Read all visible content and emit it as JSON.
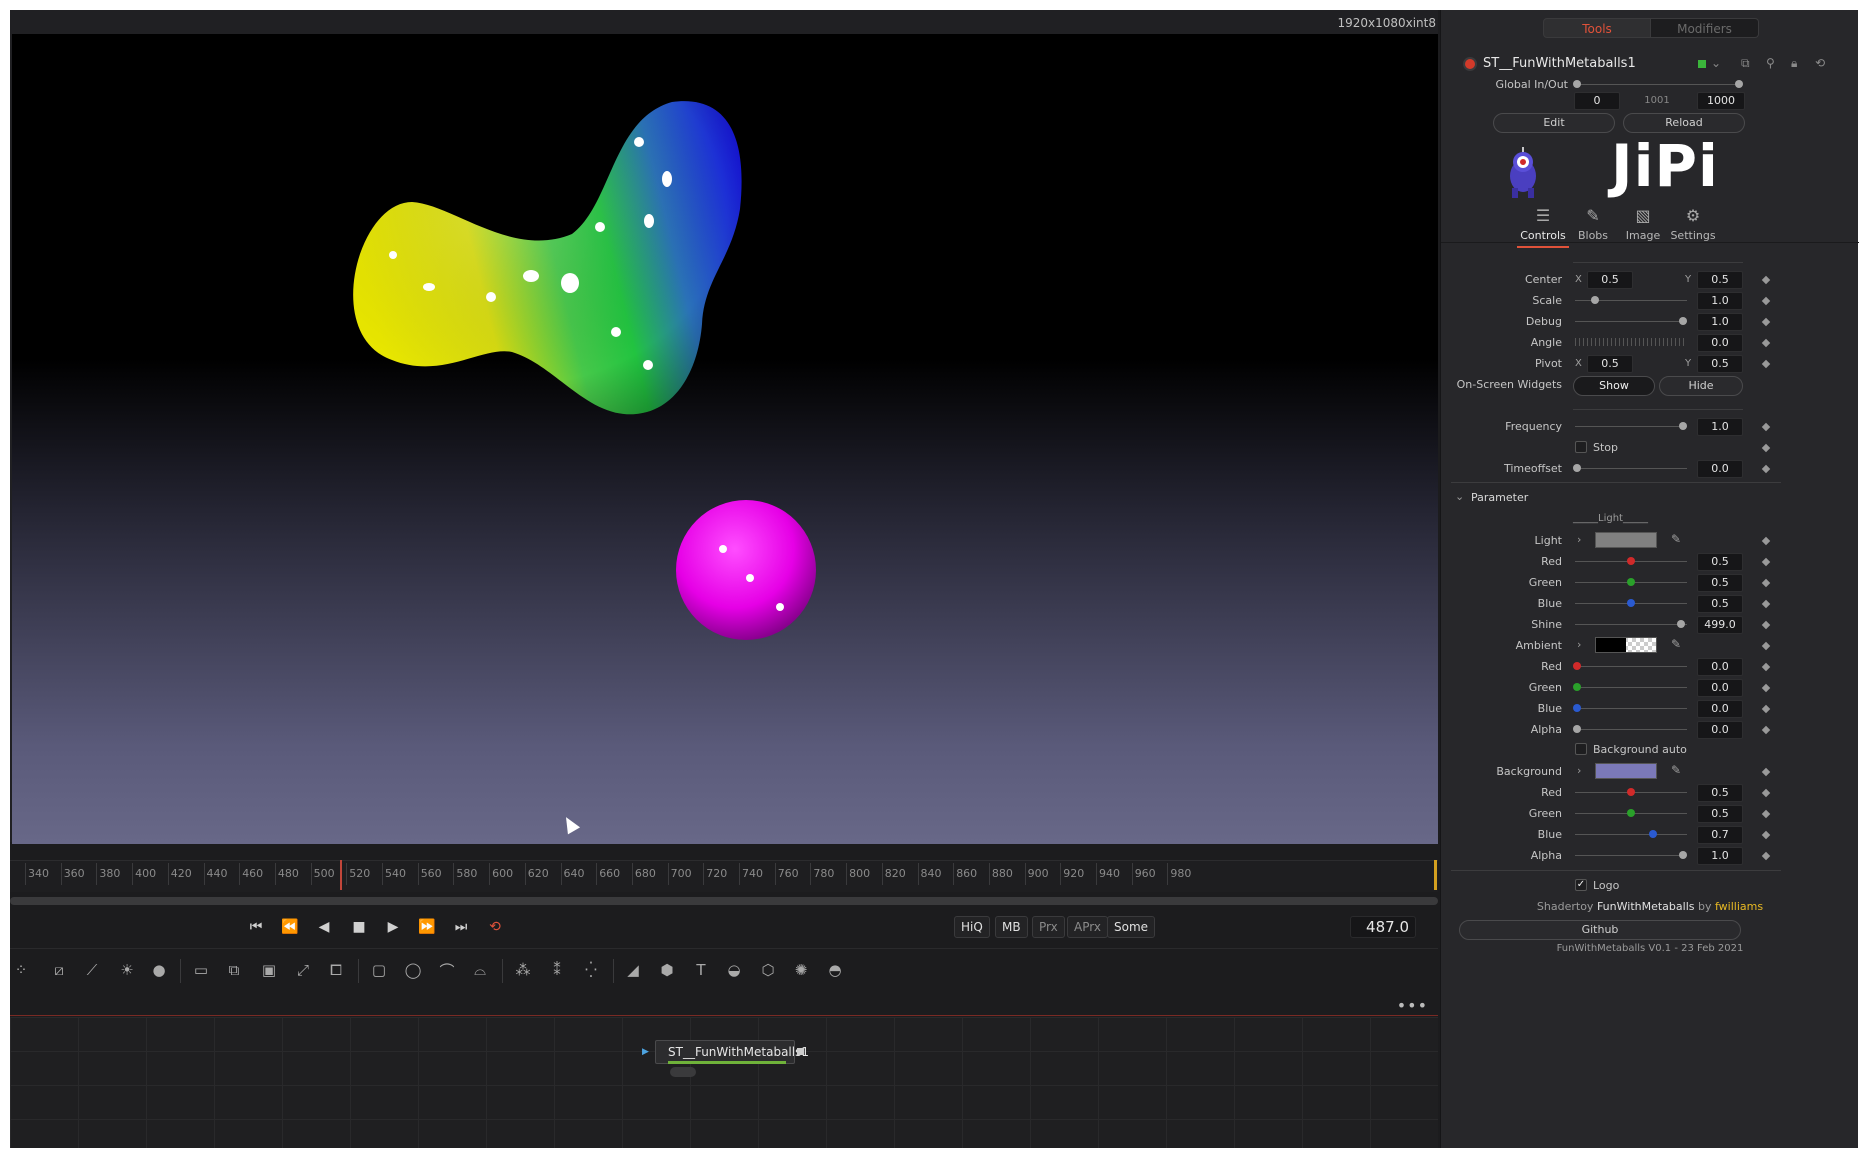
{
  "viewer": {
    "resolution": "1920x1080xint8"
  },
  "timeline": {
    "ticks": [
      "340",
      "360",
      "380",
      "400",
      "420",
      "440",
      "460",
      "480",
      "500",
      "520",
      "540",
      "560",
      "580",
      "600",
      "620",
      "640",
      "660",
      "680",
      "700",
      "720",
      "740",
      "760",
      "780",
      "800",
      "820",
      "840",
      "860",
      "880",
      "900",
      "920",
      "940",
      "960",
      "980"
    ]
  },
  "transport": {
    "quality": [
      "HiQ",
      "MB",
      "Prx",
      "APrx",
      "Some"
    ],
    "current_frame": "487.0"
  },
  "node": {
    "name": "ST__FunWithMetaballs1"
  },
  "inspector": {
    "tabs": {
      "tools": "Tools",
      "modifiers": "Modifiers"
    },
    "node_title": "ST__FunWithMetaballs1",
    "global_inout": {
      "label": "Global In/Out",
      "start": "0",
      "mid": "1001",
      "end": "1000"
    },
    "edit_label": "Edit",
    "reload_label": "Reload",
    "logo_text": "JiPi",
    "control_tabs": [
      "Controls",
      "Blobs",
      "Image",
      "Settings"
    ],
    "center": {
      "label": "Center",
      "x": "0.5",
      "y": "0.5"
    },
    "scale": {
      "label": "Scale",
      "value": "1.0"
    },
    "debug": {
      "label": "Debug",
      "value": "1.0"
    },
    "angle": {
      "label": "Angle",
      "value": "0.0"
    },
    "pivot": {
      "label": "Pivot",
      "x": "0.5",
      "y": "0.5"
    },
    "widgets": {
      "label": "On-Screen Widgets",
      "show": "Show",
      "hide": "Hide"
    },
    "frequency": {
      "label": "Frequency",
      "value": "1.0"
    },
    "stop_label": "Stop",
    "timeoffset": {
      "label": "Timeoffset",
      "value": "0.0"
    },
    "parameter_header": "Parameter",
    "light_group": "_____Light_____",
    "light": {
      "label": "Light",
      "swatch_color": "#808080",
      "red": "0.5",
      "green": "0.5",
      "blue": "0.5",
      "shine_label": "Shine",
      "shine": "499.0"
    },
    "ambient": {
      "label": "Ambient",
      "red": "0.0",
      "green": "0.0",
      "blue": "0.0",
      "alpha": "0.0"
    },
    "background_auto": "Background auto",
    "background": {
      "label": "Background",
      "swatch_color": "#7b79b8",
      "red": "0.5",
      "green": "0.5",
      "blue": "0.7",
      "alpha": "1.0"
    },
    "channel_labels": {
      "red": "Red",
      "green": "Green",
      "blue": "Blue",
      "alpha": "Alpha"
    },
    "logo_label": "Logo",
    "credit": {
      "prefix": "Shadertoy",
      "title": "FunWithMetaballs",
      "by": "by",
      "author": "fwilliams"
    },
    "github_label": "Github",
    "version": "FunWithMetaballs V0.1 - 23 Feb 2021"
  },
  "colors": {
    "accent": "#e0523a",
    "panel": "#27272a",
    "node_bar": "#6fb23a"
  }
}
